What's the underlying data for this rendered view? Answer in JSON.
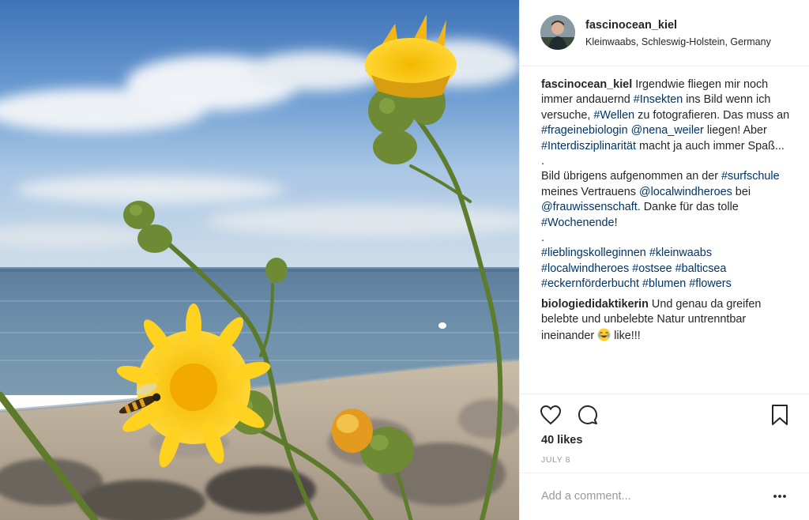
{
  "post": {
    "username": "fascinocean_kiel",
    "location": "Kleinwaabs, Schleswig-Holstein, Germany"
  },
  "caption": {
    "author": "fascinocean_kiel",
    "parts": [
      " Irgendwie fliegen mir noch immer andauernd ",
      "#Insekten",
      " ins Bild wenn ich versuche, ",
      "#Wellen",
      " zu fotografieren. Das muss an ",
      "#frageinebiologin",
      " ",
      "@nena_weiler",
      " liegen! Aber ",
      "#Interdisziplinarität",
      " macht ja auch immer Spaß...",
      ".",
      "Bild übrigens aufgenommen an der ",
      "#surfschule",
      " meines Vertrauens ",
      "@localwindheroes",
      " bei ",
      "@frauwissenschaft",
      ". Danke für das tolle ",
      "#Wochenende",
      "!",
      ".",
      "#lieblingskolleginnen",
      " ",
      "#kleinwaabs",
      " ",
      "#localwindheroes",
      " ",
      "#ostsee",
      " ",
      "#balticsea",
      " ",
      "#eckernförderbucht",
      " ",
      "#blumen",
      " ",
      "#flowers"
    ]
  },
  "comment": {
    "author": "biologiedidaktikerin",
    "text_before_emoji": " Und genau da greifen belebte und unbelebte Natur untrenntbar ineinander ",
    "emoji": "face-with-tears-of-joy",
    "text_after_emoji": " like!!!"
  },
  "actions": {
    "icons": [
      "heart-icon",
      "comment-icon",
      "bookmark-icon"
    ],
    "likes": "40 likes",
    "date": "JULY 8"
  },
  "add_comment": {
    "placeholder": "Add a comment...",
    "more_icon": "more-options-icon"
  },
  "colors": {
    "text": "#262626",
    "hashtag": "#003569",
    "muted": "#999999",
    "border": "#efefef"
  }
}
